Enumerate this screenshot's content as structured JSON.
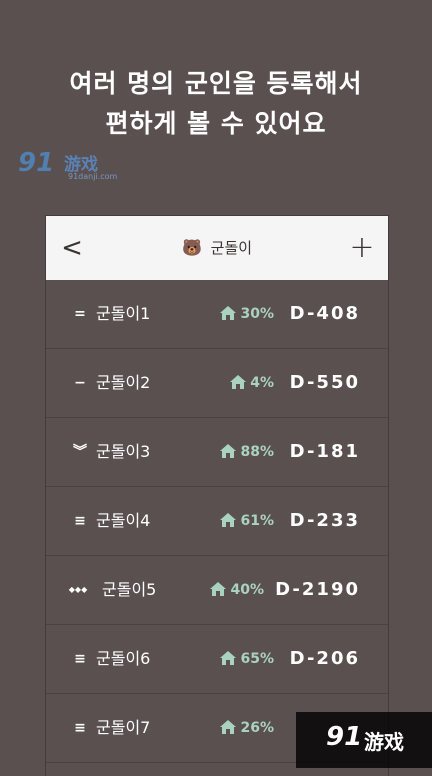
{
  "promo": {
    "line1": "여러 명의 군인을 등록해서",
    "line2": "편하게 볼 수 있어요"
  },
  "watermark_top": {
    "logo": "91",
    "brand": "游戏",
    "url": "91danji.com"
  },
  "navbar": {
    "back_icon": "<",
    "title_icon": "🐻",
    "title": "군돌이",
    "add_icon": "+"
  },
  "colors": {
    "background": "#5b5050",
    "navbar_bg": "#f6f5f5",
    "accent_green": "#a9d2c1",
    "text": "#ffffff"
  },
  "soldiers": [
    {
      "handle": "=",
      "name": "군돌이1",
      "percent": "30%",
      "dday": "D-408"
    },
    {
      "handle": "−",
      "name": "군돌이2",
      "percent": "4%",
      "dday": "D-550"
    },
    {
      "handle": "︾",
      "name": "군돌이3",
      "percent": "88%",
      "dday": "D-181"
    },
    {
      "handle": "≡",
      "name": "군돌이4",
      "percent": "61%",
      "dday": "D-233"
    },
    {
      "handle": "◆◆◆",
      "name": "군돌이5",
      "percent": "40%",
      "dday": "D-2190"
    },
    {
      "handle": "≡",
      "name": "군돌이6",
      "percent": "65%",
      "dday": "D-206"
    },
    {
      "handle": "≡",
      "name": "군돌이7",
      "percent": "26%",
      "dday": ""
    }
  ],
  "watermark_bottom": {
    "logo": "91",
    "brand": "游戏"
  }
}
